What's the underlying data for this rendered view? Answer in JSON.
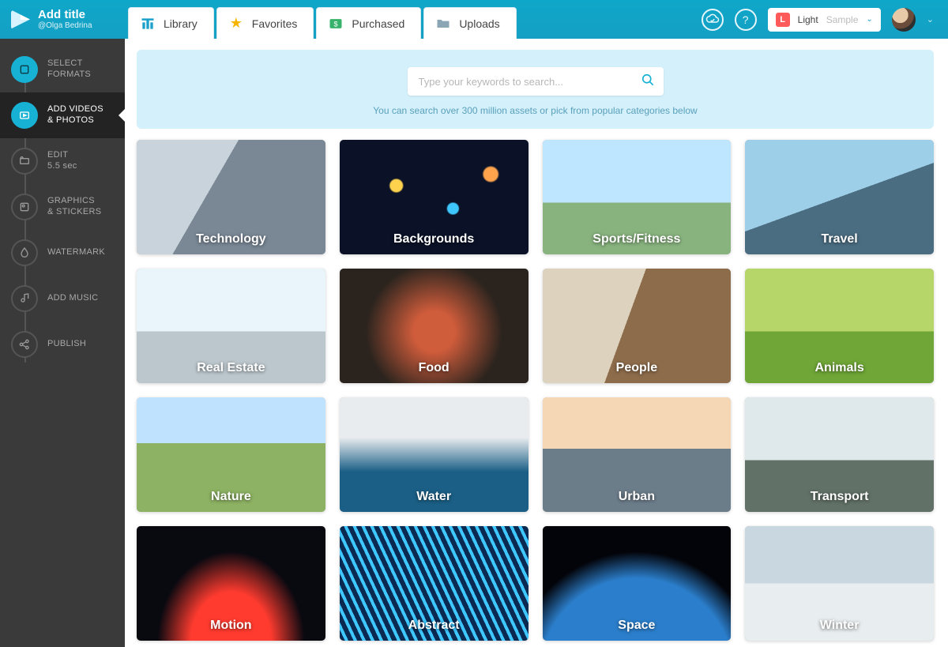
{
  "header": {
    "title": "Add title",
    "username": "@Olga Bedrina",
    "tabs": [
      {
        "label": "Library",
        "icon": "library-icon"
      },
      {
        "label": "Favorites",
        "icon": "star-icon"
      },
      {
        "label": "Purchased",
        "icon": "money-icon"
      },
      {
        "label": "Uploads",
        "icon": "folder-icon"
      }
    ],
    "theme_label": "Light",
    "theme_sample": "Sample",
    "theme_badge": "L"
  },
  "sidebar": {
    "items": [
      {
        "label": "SELECT\nFORMATS",
        "state": "done"
      },
      {
        "label": "ADD VIDEOS\n& PHOTOS",
        "state": "active"
      },
      {
        "label": "EDIT\n5.5 sec",
        "state": ""
      },
      {
        "label": "GRAPHICS\n& STICKERS",
        "state": ""
      },
      {
        "label": "WATERMARK",
        "state": ""
      },
      {
        "label": "ADD MUSIC",
        "state": ""
      },
      {
        "label": "PUBLISH",
        "state": ""
      }
    ]
  },
  "search": {
    "placeholder": "Type your keywords to search...",
    "hint": "You can search over 300 million assets or pick from popular categories below"
  },
  "categories": [
    "Technology",
    "Backgrounds",
    "Sports/Fitness",
    "Travel",
    "Real Estate",
    "Food",
    "People",
    "Animals",
    "Nature",
    "Water",
    "Urban",
    "Transport",
    "Motion",
    "Abstract",
    "Space",
    "Winter"
  ]
}
